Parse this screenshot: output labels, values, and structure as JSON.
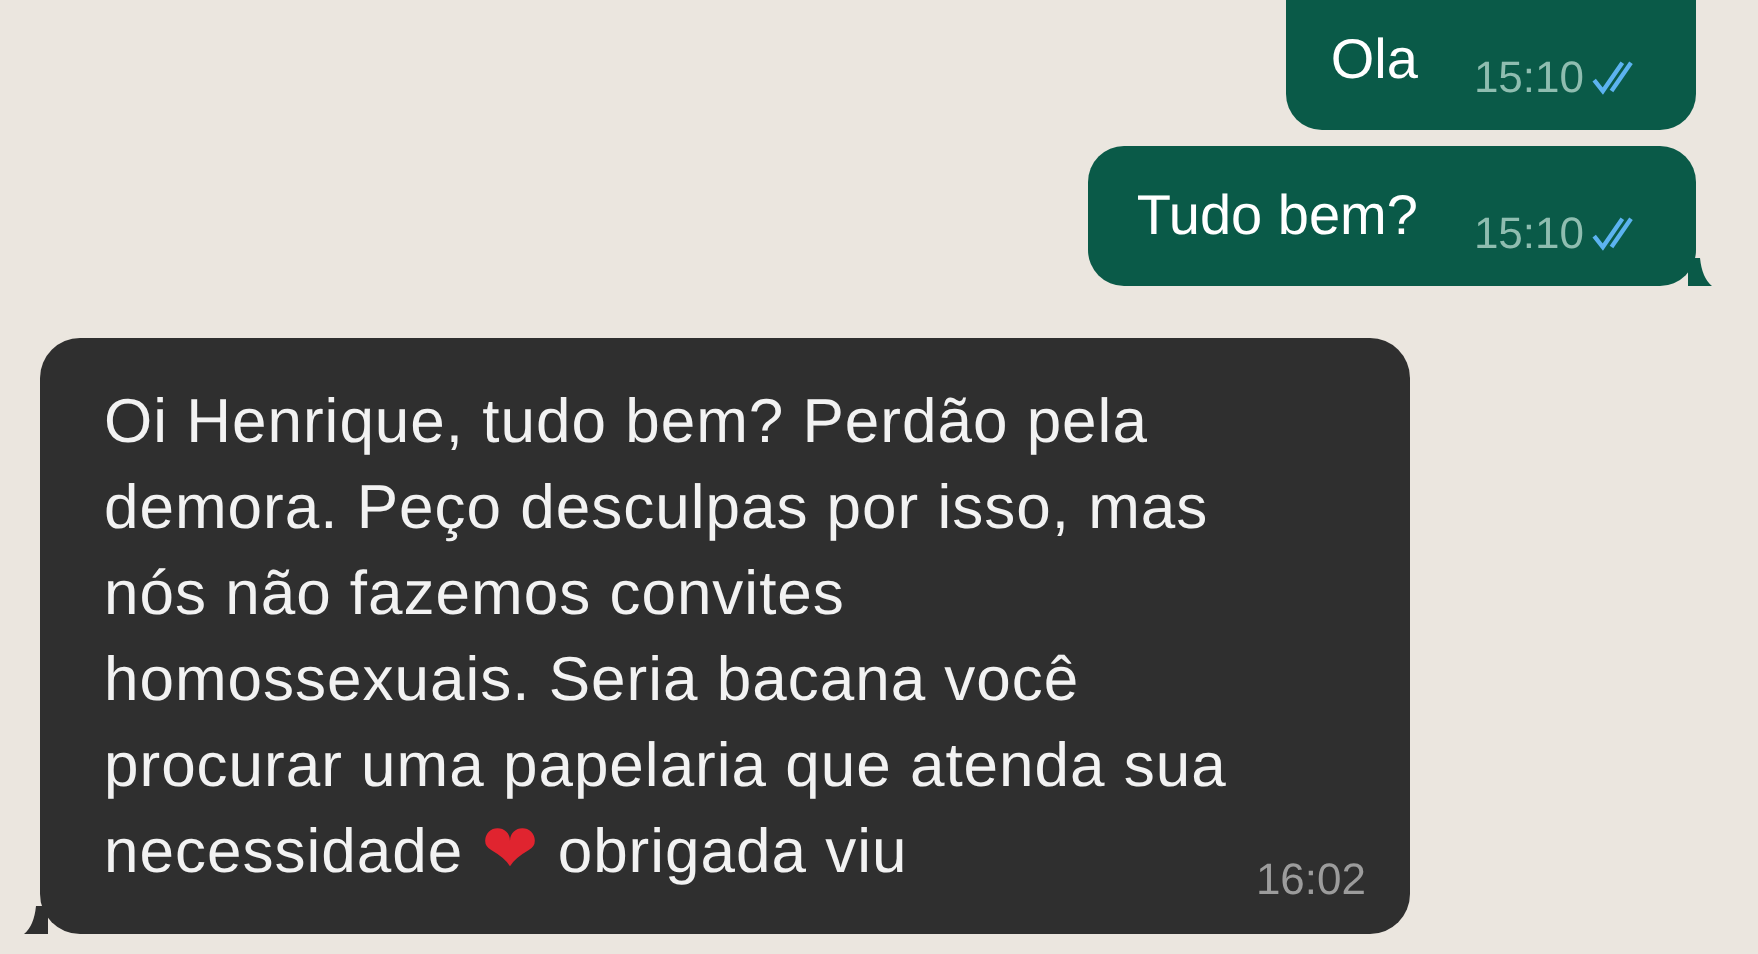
{
  "messages": [
    {
      "kind": "sent",
      "text": "Ola",
      "time": "15:10",
      "read": true,
      "tail": false
    },
    {
      "kind": "sent",
      "text": "Tudo bem?",
      "time": "15:10",
      "read": true,
      "tail": true
    },
    {
      "kind": "received",
      "parts": [
        {
          "kind": "text",
          "text": "Oi Henrique, tudo bem? Perdão pela demora. Peço desculpas por isso, mas nós não fazemos convites homossexuais. Seria bacana você procurar uma papelaria que atenda sua necessidade"
        },
        {
          "kind": "emoji",
          "text": "❤"
        },
        {
          "kind": "text",
          "text": "obrigada viu"
        }
      ],
      "time": "16:02",
      "tail": true
    }
  ]
}
